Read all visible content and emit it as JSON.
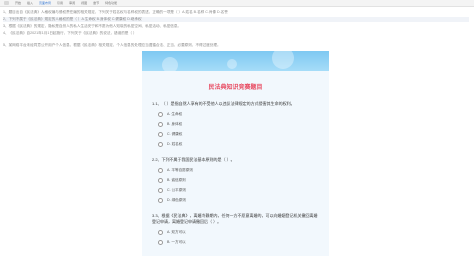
{
  "toolbar": {
    "items": [
      "开始",
      "插入",
      "页面布局",
      "引用",
      "审阅",
      "视图",
      "章节",
      "特色功能"
    ],
    "active": "页面布局"
  },
  "doc_lines": [
    "1、题目出自《民法典》人格权编与侵权责任编的相关规定，下列关于姓名权与名称权的表述，正确的一项是（ ）A.姓名 B.名称 C.肖像 D.名誉",
    "2、下列不属于《民法典》规定的人格权的是（ ）A.生命权 B.身体权 C.健康权 D.继承权",
    "3、根据《民法典》的规定，隐私是自然人的私人生活安宁和不愿为他人知晓的私密空间、私密活动、私密信息。",
    "4、《民法典》自2021年1月1日起施行，下列关于《民法典》的说法，错误的是（ ）",
    "5、某网络平台未经同意公开用户个人信息，根据《民法典》相关规定，个人信息的处理应当遵循合法、正当、必要原则，不得过度处理。"
  ],
  "quiz": {
    "title": "民法典知识竞赛题目",
    "questions": [
      {
        "text": "1.1、（ ）是指自然人享有的不受他人以违反法律规定的方式侵害其生命的权利。",
        "options": [
          "A. 生命权",
          "B. 身体权",
          "C. 健康权",
          "D. 姓名权"
        ]
      },
      {
        "text": "2.2、下列不属于我国民法基本原则的是（ ）。",
        "options": [
          "A. 平等自愿原则",
          "B. 诚信原则",
          "C. 公平原则",
          "D. 绿色原则"
        ]
      },
      {
        "text": "3.3、根据《民法典》，离婚冷静期内，任何一方不愿意离婚的，可以向婚姻登记机关撤回离婚登记申请，离婚登记申请撤回后（ ）。",
        "options": [
          "A. 双方可以",
          "B. 一方可以"
        ]
      }
    ]
  }
}
